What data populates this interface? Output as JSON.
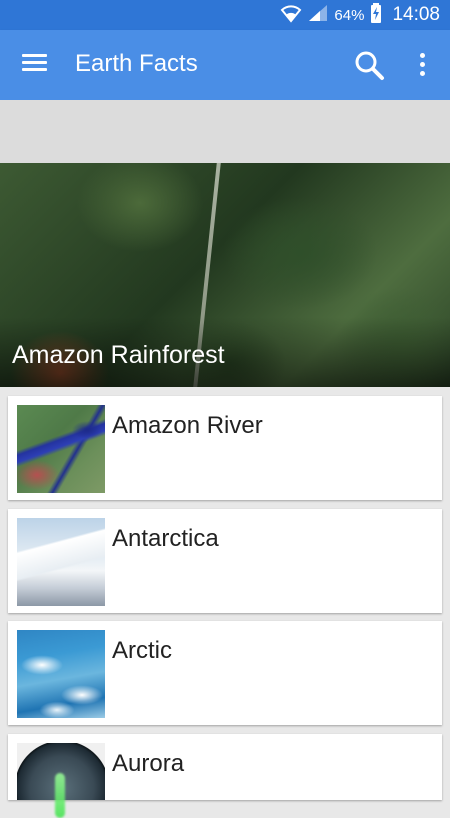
{
  "status_bar": {
    "battery": "64%",
    "time": "14:08"
  },
  "app_bar": {
    "title": "Earth Facts",
    "icons": [
      "menu-icon",
      "search-icon",
      "more-vert-icon"
    ]
  },
  "featured": {
    "title": "Amazon Rainforest"
  },
  "list": {
    "items": [
      {
        "label": "Amazon River"
      },
      {
        "label": "Antarctica"
      },
      {
        "label": "Arctic"
      },
      {
        "label": "Aurora"
      }
    ]
  },
  "colors": {
    "status_bar": "#2f76d6",
    "app_bar": "#4a8ee6",
    "background": "#e8e8e8"
  }
}
